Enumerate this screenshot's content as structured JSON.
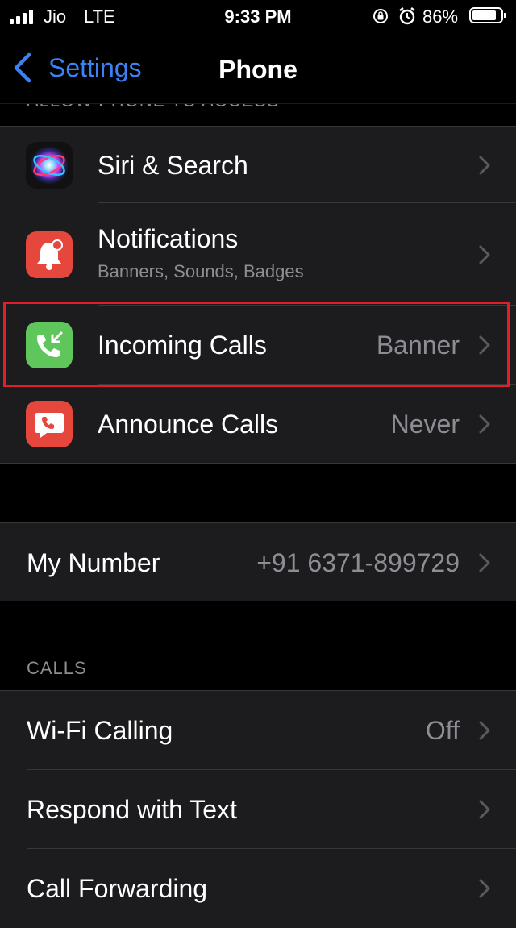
{
  "status_bar": {
    "carrier": "Jio",
    "network": "LTE",
    "time": "9:33 PM",
    "battery_percent": "86%",
    "battery_level": 0.86
  },
  "nav": {
    "back_label": "Settings",
    "title": "Phone"
  },
  "allow_section": {
    "header": "ALLOW PHONE TO ACCESS",
    "items": [
      {
        "label": "Siri & Search",
        "icon": "siri-icon"
      },
      {
        "label": "Notifications",
        "sublabel": "Banners, Sounds, Badges",
        "icon": "notifications-bell-icon",
        "icon_color": "#e5473c"
      },
      {
        "label": "Incoming Calls",
        "value": "Banner",
        "icon": "incoming-call-icon",
        "icon_color": "#5ec65a"
      },
      {
        "label": "Announce Calls",
        "value": "Never",
        "icon": "announce-calls-icon",
        "icon_color": "#e5473c"
      }
    ]
  },
  "number_section": {
    "items": [
      {
        "label": "My Number",
        "value": "+91 6371-899729"
      }
    ]
  },
  "calls_section": {
    "header": "CALLS",
    "items": [
      {
        "label": "Wi-Fi Calling",
        "value": "Off"
      },
      {
        "label": "Respond with Text"
      },
      {
        "label": "Call Forwarding"
      }
    ]
  },
  "colors": {
    "accent": "#3a82f6",
    "highlight_box": "#e21e2b",
    "cell_background": "#1c1c1e"
  }
}
